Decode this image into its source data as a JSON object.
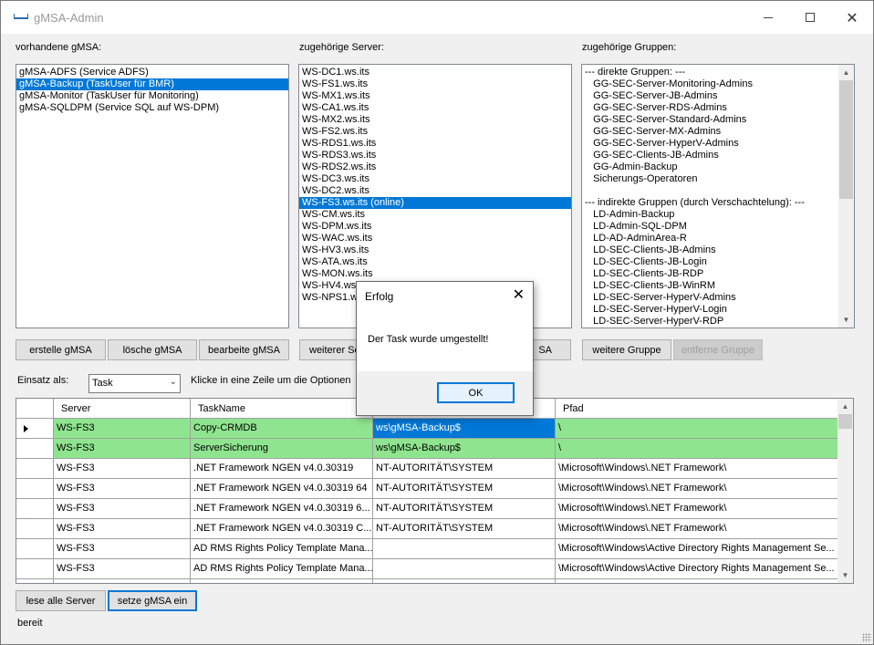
{
  "window": {
    "title": "gMSA-Admin"
  },
  "labels": {
    "gmsa": "vorhandene gMSA:",
    "server": "zugehörige Server:",
    "groups": "zugehörige Gruppen:",
    "einsatz": "Einsatz als:",
    "hint": "Klicke in eine Zeile um die Optionen",
    "status": "bereit"
  },
  "gmsa_list": {
    "items": [
      "gMSA-ADFS (Service ADFS)",
      "gMSA-Backup (TaskUser für BMR)",
      "gMSA-Monitor (TaskUser für Monitoring)",
      "gMSA-SQLDPM (Service SQL auf WS-DPM)"
    ],
    "selected_index": 1
  },
  "server_list": {
    "items": [
      "WS-DC1.ws.its",
      "WS-FS1.ws.its",
      "WS-MX1.ws.its",
      "WS-CA1.ws.its",
      "WS-MX2.ws.its",
      "WS-FS2.ws.its",
      "WS-RDS1.ws.its",
      "WS-RDS3.ws.its",
      "WS-RDS2.ws.its",
      "WS-DC3.ws.its",
      "WS-DC2.ws.its",
      "WS-FS3.ws.its (online)",
      "WS-CM.ws.its",
      "WS-DPM.ws.its",
      "WS-WAC.ws.its",
      "WS-HV3.ws.its",
      "WS-ATA.ws.its",
      "WS-MON.ws.its",
      "WS-HV4.ws",
      "WS-NPS1.w"
    ],
    "selected_index": 11
  },
  "group_list": {
    "items": [
      "--- direkte Gruppen: ---",
      "   GG-SEC-Server-Monitoring-Admins",
      "   GG-SEC-Server-JB-Admins",
      "   GG-SEC-Server-RDS-Admins",
      "   GG-SEC-Server-Standard-Admins",
      "   GG-SEC-Server-MX-Admins",
      "   GG-SEC-Server-HyperV-Admins",
      "   GG-SEC-Clients-JB-Admins",
      "   GG-Admin-Backup",
      "   Sicherungs-Operatoren",
      "",
      "--- indirekte Gruppen (durch Verschachtelung): ---",
      "   LD-Admin-Backup",
      "   LD-Admin-SQL-DPM",
      "   LD-AD-AdminArea-R",
      "   LD-SEC-Clients-JB-Admins",
      "   LD-SEC-Clients-JB-Login",
      "   LD-SEC-Clients-JB-RDP",
      "   LD-SEC-Clients-JB-WinRM",
      "   LD-SEC-Server-HyperV-Admins",
      "   LD-SEC-Server-HyperV-Login",
      "   LD-SEC-Server-HyperV-RDP"
    ]
  },
  "buttons": {
    "create": "erstelle gMSA",
    "delete": "lösche gMSA",
    "edit": "bearbeite gMSA",
    "more_server": "weiterer Se",
    "remove_server": "SA",
    "more_group": "weitere Gruppe",
    "remove_group": "entferne Gruppe",
    "read_all": "lese alle Server",
    "set_gmsa": "setze gMSA ein"
  },
  "einsatz_combo": {
    "value": "Task"
  },
  "grid": {
    "columns": [
      "Server",
      "TaskName",
      "",
      "Pfad"
    ],
    "rows": [
      {
        "server": "WS-FS3",
        "task": "Copy-CRMDB",
        "user": "ws\\gMSA-Backup$",
        "path": "\\",
        "style": "green",
        "current": true
      },
      {
        "server": "WS-FS3",
        "task": "ServerSicherung",
        "user": "ws\\gMSA-Backup$",
        "path": "\\",
        "style": "green"
      },
      {
        "server": "WS-FS3",
        "task": ".NET Framework NGEN v4.0.30319",
        "user": "NT-AUTORITÄT\\SYSTEM",
        "path": "\\Microsoft\\Windows\\.NET Framework\\",
        "style": "white"
      },
      {
        "server": "WS-FS3",
        "task": ".NET Framework NGEN v4.0.30319 64",
        "user": "NT-AUTORITÄT\\SYSTEM",
        "path": "\\Microsoft\\Windows\\.NET Framework\\",
        "style": "white"
      },
      {
        "server": "WS-FS3",
        "task": ".NET Framework NGEN v4.0.30319 6...",
        "user": "NT-AUTORITÄT\\SYSTEM",
        "path": "\\Microsoft\\Windows\\.NET Framework\\",
        "style": "white"
      },
      {
        "server": "WS-FS3",
        "task": ".NET Framework NGEN v4.0.30319 C...",
        "user": "NT-AUTORITÄT\\SYSTEM",
        "path": "\\Microsoft\\Windows\\.NET Framework\\",
        "style": "white"
      },
      {
        "server": "WS-FS3",
        "task": "AD RMS Rights Policy Template Mana...",
        "user": "",
        "path": "\\Microsoft\\Windows\\Active Directory Rights Management Se...",
        "style": "white"
      },
      {
        "server": "WS-FS3",
        "task": "AD RMS Rights Policy Template Mana...",
        "user": "",
        "path": "\\Microsoft\\Windows\\Active Directory Rights Management Se...",
        "style": "white"
      },
      {
        "server": "",
        "task": "",
        "user": "",
        "path": "",
        "style": "white"
      }
    ]
  },
  "dialog": {
    "title": "Erfolg",
    "message": "Der Task wurde umgestellt!",
    "ok": "OK"
  },
  "colors": {
    "accent": "#0078d7",
    "row_green": "#8fe58f"
  }
}
